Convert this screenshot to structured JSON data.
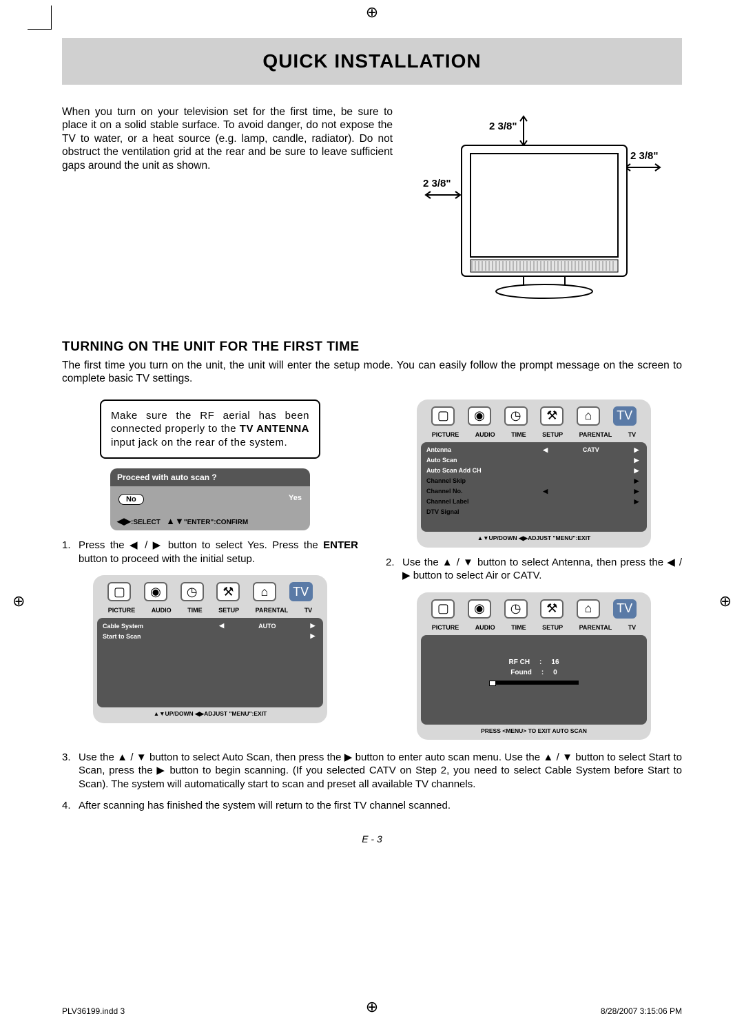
{
  "title": "QUICK INSTALLATION",
  "intro": "When you turn on your television set for the first time, be sure to place it on a solid stable surface. To avoid danger, do not expose the TV to water, or a heat source (e.g. lamp, candle, radiator). Do not obstruct the ventilation grid at the rear and be sure to leave sufficient gaps around the unit as shown.",
  "clearance": {
    "top": "2 3/8\"",
    "left": "2 3/8\"",
    "right": "2 3/8\""
  },
  "section_heading": "TURNING ON THE UNIT FOR THE FIRST TIME",
  "section_para": "The first time you turn on the unit, the unit will enter the setup mode. You can easily follow the prompt message on the screen to complete basic TV settings.",
  "note_pre": "Make sure the RF aerial has been connected properly to the ",
  "note_bold": "TV ANTENNA",
  "note_post": " input jack on the rear of the system.",
  "dialog": {
    "title": "Proceed with auto scan ?",
    "no": "No",
    "yes": "Yes",
    "foot_select": ":SELECT",
    "foot_confirm": "\"ENTER\":CONFIRM"
  },
  "tabs": [
    "PICTURE",
    "AUDIO",
    "TIME",
    "SETUP",
    "PARENTAL",
    "TV"
  ],
  "menu1_rows": [
    {
      "label": "Antenna",
      "left": "◀",
      "value": "CATV",
      "right": "▶",
      "alt": false
    },
    {
      "label": "Auto Scan",
      "left": "",
      "value": "",
      "right": "▶",
      "alt": false
    },
    {
      "label": "Auto Scan Add CH",
      "left": "",
      "value": "",
      "right": "▶",
      "alt": false
    },
    {
      "label": "Channel Skip",
      "left": "",
      "value": "",
      "right": "▶",
      "alt": true
    },
    {
      "label": "Channel No.",
      "left": "◀",
      "value": "",
      "right": "▶",
      "alt": true
    },
    {
      "label": "Channel Label",
      "left": "",
      "value": "",
      "right": "▶",
      "alt": true
    },
    {
      "label": "DTV Signal",
      "left": "",
      "value": "",
      "right": "",
      "alt": true
    }
  ],
  "menu_foot": "▲▼UP/DOWN  ◀▶ADJUST  \"MENU\":EXIT",
  "menu3_rows": [
    {
      "label": "Cable System",
      "left": "◀",
      "value": "AUTO",
      "right": "▶",
      "alt": false
    },
    {
      "label": "Start to Scan",
      "left": "",
      "value": "",
      "right": "▶",
      "alt": false
    }
  ],
  "scan": {
    "rf_label": "RF CH",
    "rf_val": "16",
    "found_label": "Found",
    "found_val": "0",
    "foot": "PRESS <MENU> TO EXIT AUTO SCAN"
  },
  "steps": {
    "s1_pre": "Press the  ◀ / ▶ button to select Yes. Press the ",
    "s1_bold": "ENTER",
    "s1_post": " button to proceed with the initial setup.",
    "s2": "Use the ▲ / ▼ button to select Antenna, then press the ◀ / ▶ button to select Air or CATV.",
    "s3": "Use the ▲ / ▼ button to select Auto Scan, then press the ▶ button to enter auto scan menu. Use the ▲ / ▼ button to select Start to Scan, press the ▶ button to begin scanning. (If you selected CATV on Step 2, you need to select Cable System before Start to Scan). The system will automatically start to scan and preset all available TV channels.",
    "s4": "After scanning has finished the system will return to the first TV channel scanned."
  },
  "page_num": "E - 3",
  "footer_left": "PLV36199.indd   3",
  "footer_right": "8/28/2007   3:15:06 PM"
}
